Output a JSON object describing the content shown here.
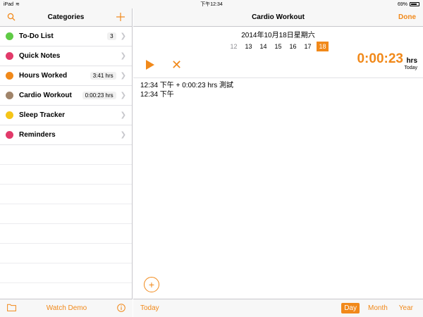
{
  "status": {
    "device": "iPad",
    "time": "下午12:34",
    "battery": "69%"
  },
  "left": {
    "title": "Categories",
    "categories": [
      {
        "label": "To-Do List",
        "badge": "3",
        "color": "#5fcb45"
      },
      {
        "label": "Quick Notes",
        "badge": "",
        "color": "#e23a6a"
      },
      {
        "label": "Hours Worked",
        "badge": "3:41 hrs",
        "color": "#f1891a"
      },
      {
        "label": "Cardio Workout",
        "badge": "0:00:23 hrs",
        "color": "#a0846a"
      },
      {
        "label": "Sleep Tracker",
        "badge": "",
        "color": "#f5c518"
      },
      {
        "label": "Reminders",
        "badge": "",
        "color": "#e23a6a"
      }
    ],
    "toolbar": {
      "watch_demo": "Watch Demo"
    }
  },
  "right": {
    "title": "Cardio Workout",
    "done": "Done",
    "date": "2014年10月18日星期六",
    "days": [
      "12",
      "13",
      "14",
      "15",
      "16",
      "17",
      "18"
    ],
    "selected_day": "18",
    "timer": {
      "value": "0:00:23",
      "unit": "hrs",
      "sub": "Today"
    },
    "log": [
      "12:34 下午  + 0:00:23 hrs  測試",
      "12:34 下午"
    ],
    "toolbar": {
      "today": "Today",
      "day": "Day",
      "month": "Month",
      "year": "Year"
    }
  },
  "colors": {
    "accent": "#f1891a"
  }
}
